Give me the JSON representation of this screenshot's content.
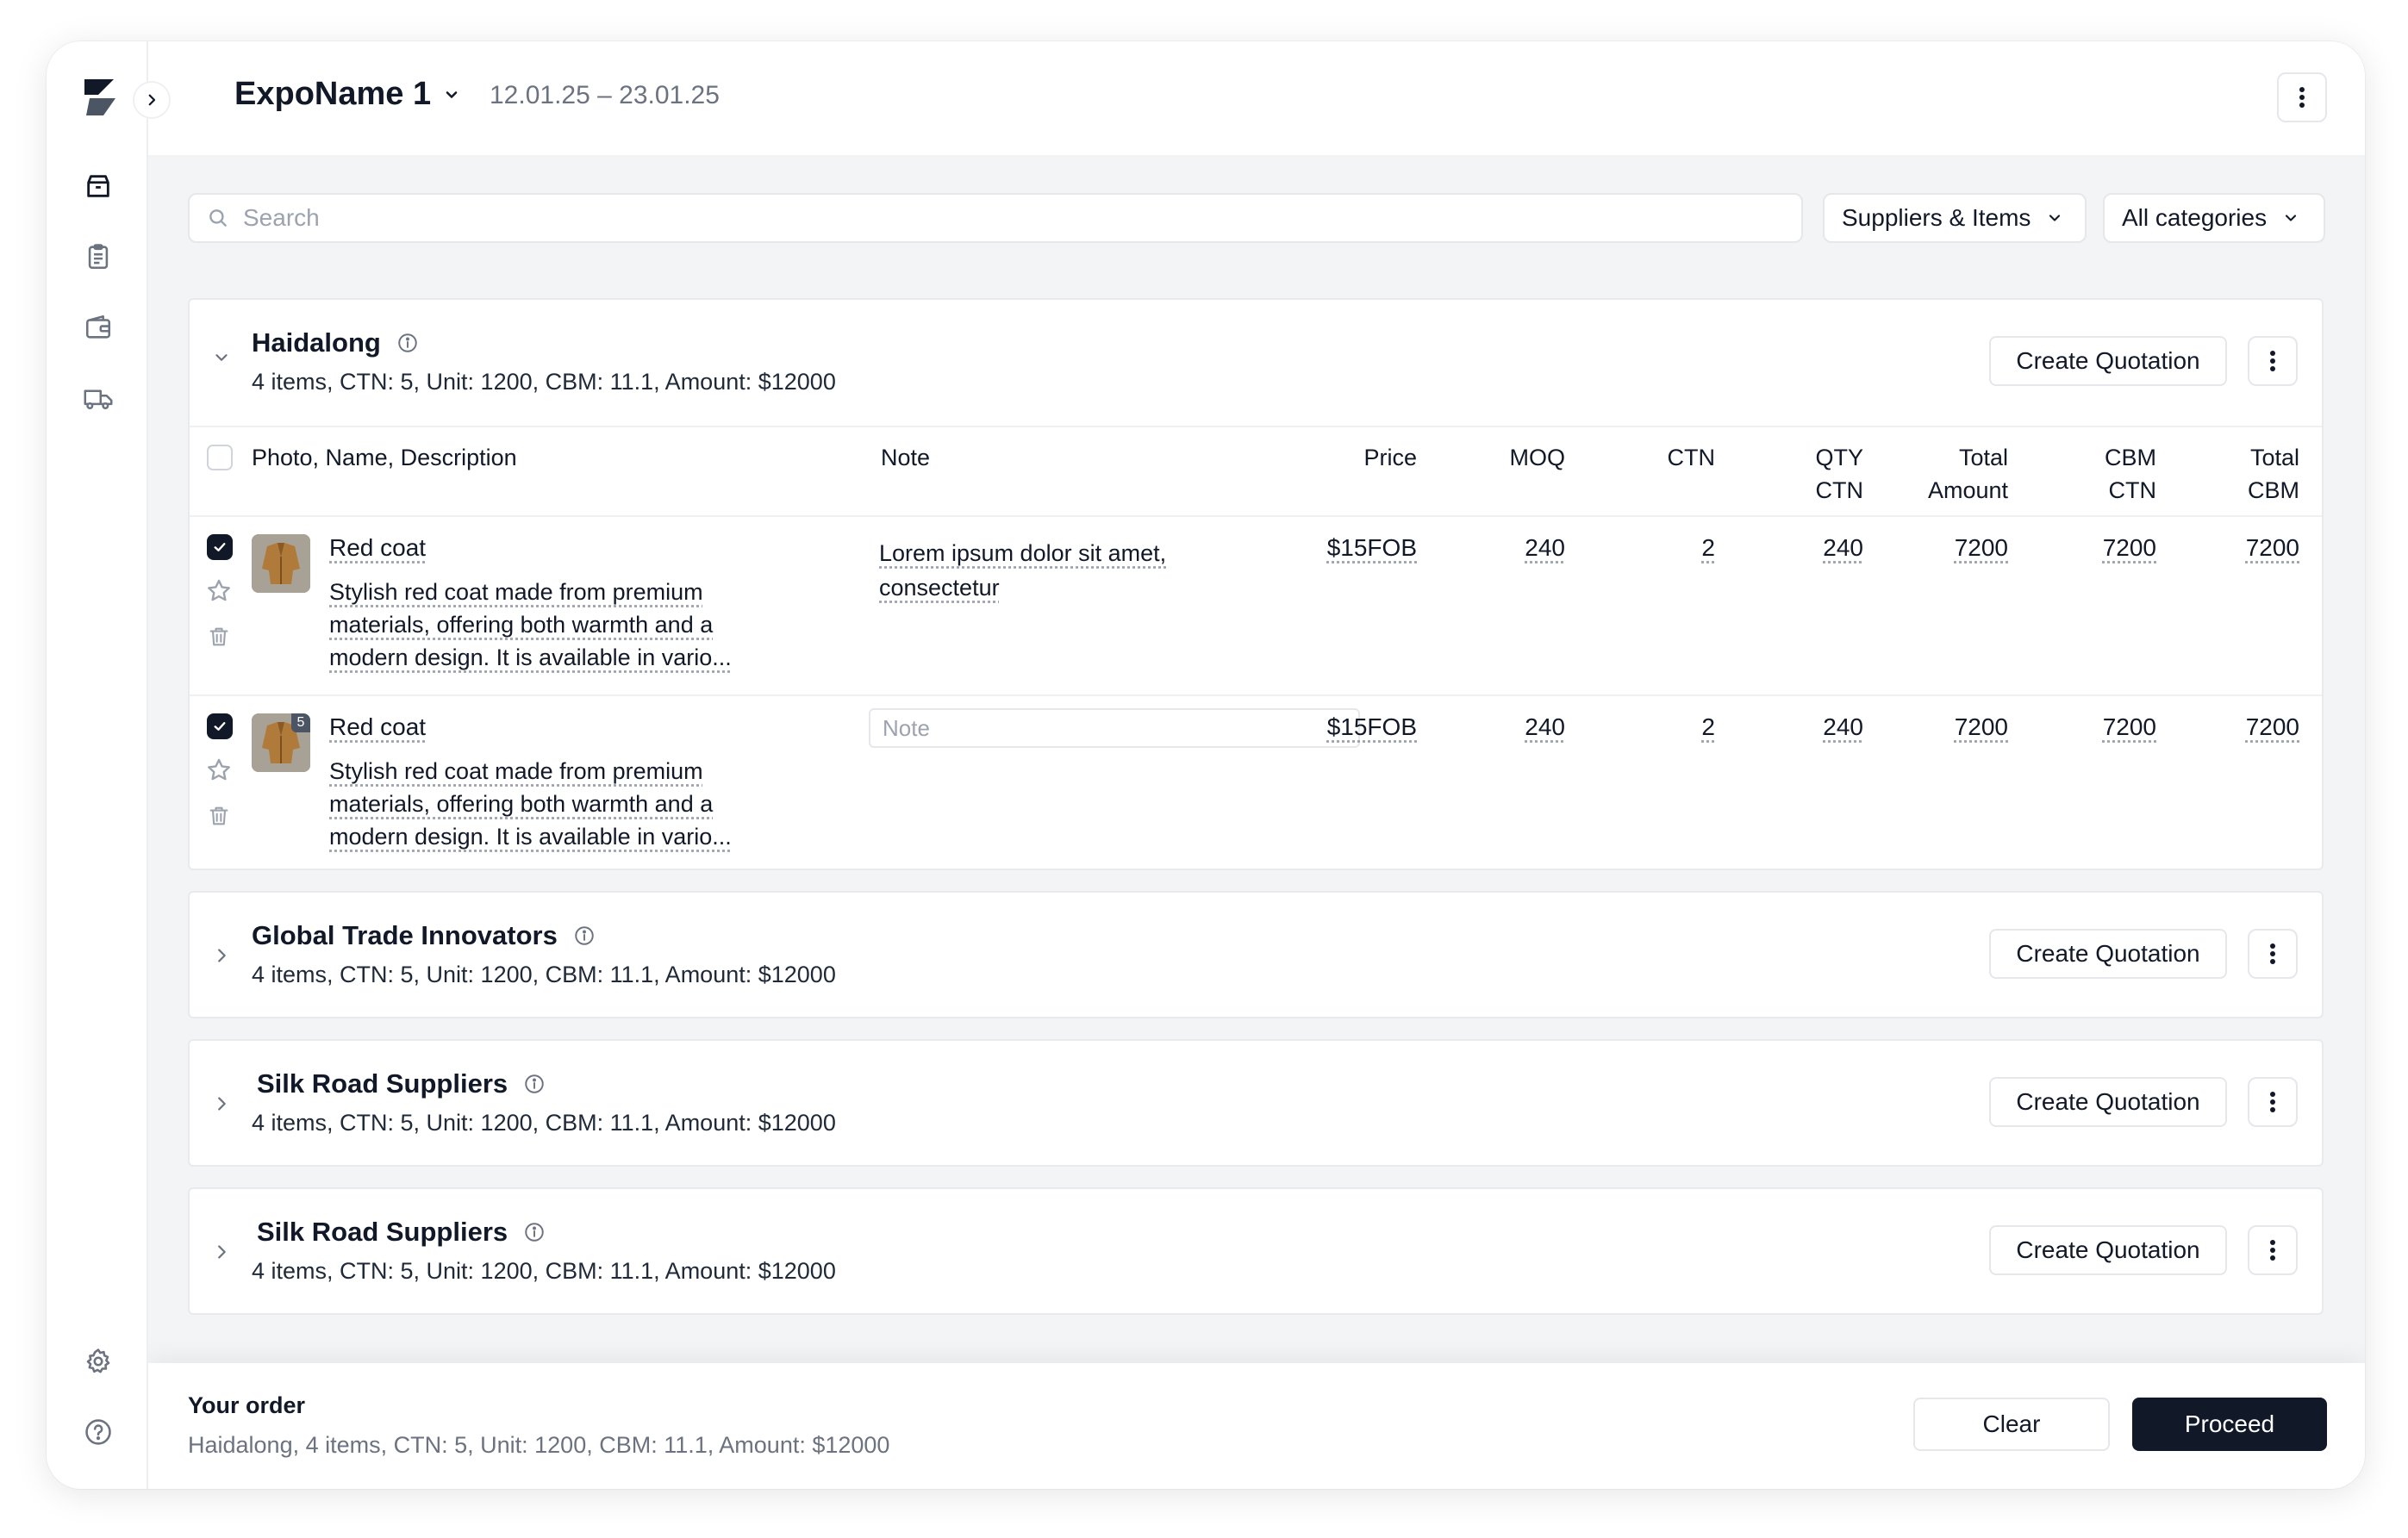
{
  "header": {
    "expo_name": "ExpoName 1",
    "dates": "12.01.25 – 23.01.25"
  },
  "sidebar": {
    "items": [
      {
        "name": "products",
        "icon": "box-icon",
        "active": true
      },
      {
        "name": "orders",
        "icon": "clipboard-icon",
        "active": false
      },
      {
        "name": "wallet",
        "icon": "wallet-icon",
        "active": false
      },
      {
        "name": "shipping",
        "icon": "truck-icon",
        "active": false
      }
    ],
    "bottom": [
      {
        "name": "settings",
        "icon": "gear-icon"
      },
      {
        "name": "help",
        "icon": "help-icon"
      }
    ]
  },
  "filters": {
    "search_placeholder": "Search",
    "view": "Suppliers & Items",
    "category": "All categories"
  },
  "table": {
    "headers": {
      "photo": "Photo, Name, Description",
      "note": "Note",
      "price": "Price",
      "moq": "MOQ",
      "ctn": "CTN",
      "qty_ctn": [
        "QTY",
        "CTN"
      ],
      "total_amount": [
        "Total",
        "Amount"
      ],
      "cbm_ctn": [
        "CBM",
        "CTN"
      ],
      "total_cbm": [
        "Total",
        "CBM"
      ]
    }
  },
  "suppliers": [
    {
      "name": "Haidalong",
      "summary": "4 items, CTN: 5, Unit: 1200, CBM: 11.1, Amount: $12000",
      "expanded": true,
      "create_label": "Create Quotation",
      "items": [
        {
          "name": "Red coat",
          "description": "Stylish red coat made from premium materials, offering both warmth and a modern design. It is available in vario...",
          "note": "Lorem ipsum dolor sit amet, consectetur",
          "note_placeholder": "",
          "badge": "",
          "checked": true,
          "price": "$15FOB",
          "moq": "240",
          "ctn": "2",
          "qty_ctn": "240",
          "total_amount": "7200",
          "cbm_ctn": "7200",
          "total_cbm": "7200"
        },
        {
          "name": "Red coat",
          "description": "Stylish red coat made from premium materials, offering both warmth and a modern design. It is available in vario...",
          "note": "",
          "note_placeholder": "Note",
          "badge": "5",
          "checked": true,
          "price": "$15FOB",
          "moq": "240",
          "ctn": "2",
          "qty_ctn": "240",
          "total_amount": "7200",
          "cbm_ctn": "7200",
          "total_cbm": "7200"
        }
      ]
    },
    {
      "name": "Global Trade Innovators",
      "summary": "4 items, CTN: 5, Unit: 1200, CBM: 11.1, Amount: $12000",
      "expanded": false,
      "create_label": "Create Quotation"
    },
    {
      "name": "Silk Road Suppliers",
      "summary": "4 items, CTN: 5, Unit: 1200, CBM: 11.1, Amount: $12000",
      "expanded": false,
      "create_label": "Create Quotation"
    },
    {
      "name": "Silk Road Suppliers",
      "summary": "4 items, CTN: 5, Unit: 1200, CBM: 11.1, Amount: $12000",
      "expanded": false,
      "create_label": "Create Quotation"
    }
  ],
  "footer": {
    "title": "Your order",
    "summary": "Haidalong, 4 items, CTN: 5, Unit: 1200, CBM: 11.1, Amount: $12000",
    "clear_label": "Clear",
    "proceed_label": "Proceed"
  },
  "colors": {
    "primary": "#111827",
    "muted": "#6b7280",
    "border": "#e5e7eb",
    "background": "#f3f4f6"
  }
}
